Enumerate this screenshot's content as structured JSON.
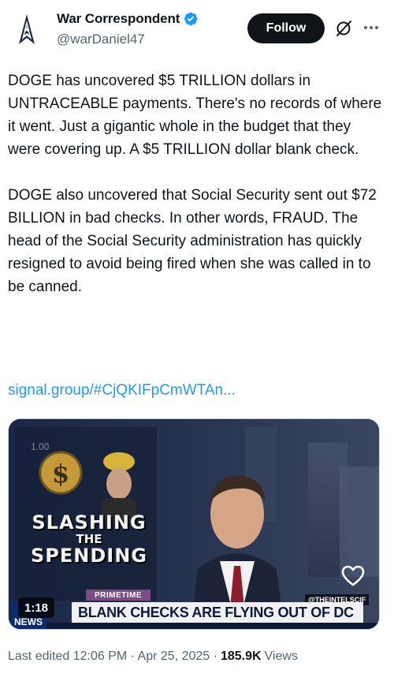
{
  "author": {
    "display_name": "War Correspondent",
    "handle": "@warDaniel47",
    "verified": true,
    "verified_color": "#1d9bf0"
  },
  "header": {
    "follow_label": "Follow",
    "grok_icon": "grok-icon",
    "more_icon": "more-icon"
  },
  "tweet": {
    "paragraphs": [
      "DOGE has uncovered $5 TRILLION dollars in UNTRACEABLE payments. There's no records of where it went. Just a gigantic whole in the budget that they were covering up. A $5 TRILLION dollar blank check.",
      "DOGE also uncovered that Social Security sent out $72 BILLION in bad checks. In other words, FRAUD. The head of the Social Security administration has quickly resigned to avoid being fired when she was called in to be canned."
    ],
    "link_text": "signal.group/#CjQKIFpCmWTAn..."
  },
  "media": {
    "duration": "1:18",
    "graphic_line1": "SLASHING",
    "graphic_line2": "THE",
    "graphic_line3": "SPENDING",
    "price_tag": "1.00",
    "chyron": "BLANK CHECKS ARE FLYING OUT OF DC",
    "show_tag": "PRIMETIME",
    "watermark": "@THEINTELSCIF",
    "network_tag": "NEWS"
  },
  "meta": {
    "last_edited": "Last edited 12:06 PM · Apr 25, 2025 ·",
    "views_count": "185.9K",
    "views_label": "Views"
  },
  "colors": {
    "link": "#1d9bf0",
    "follow_bg": "#0f1419",
    "muted": "#536471"
  }
}
